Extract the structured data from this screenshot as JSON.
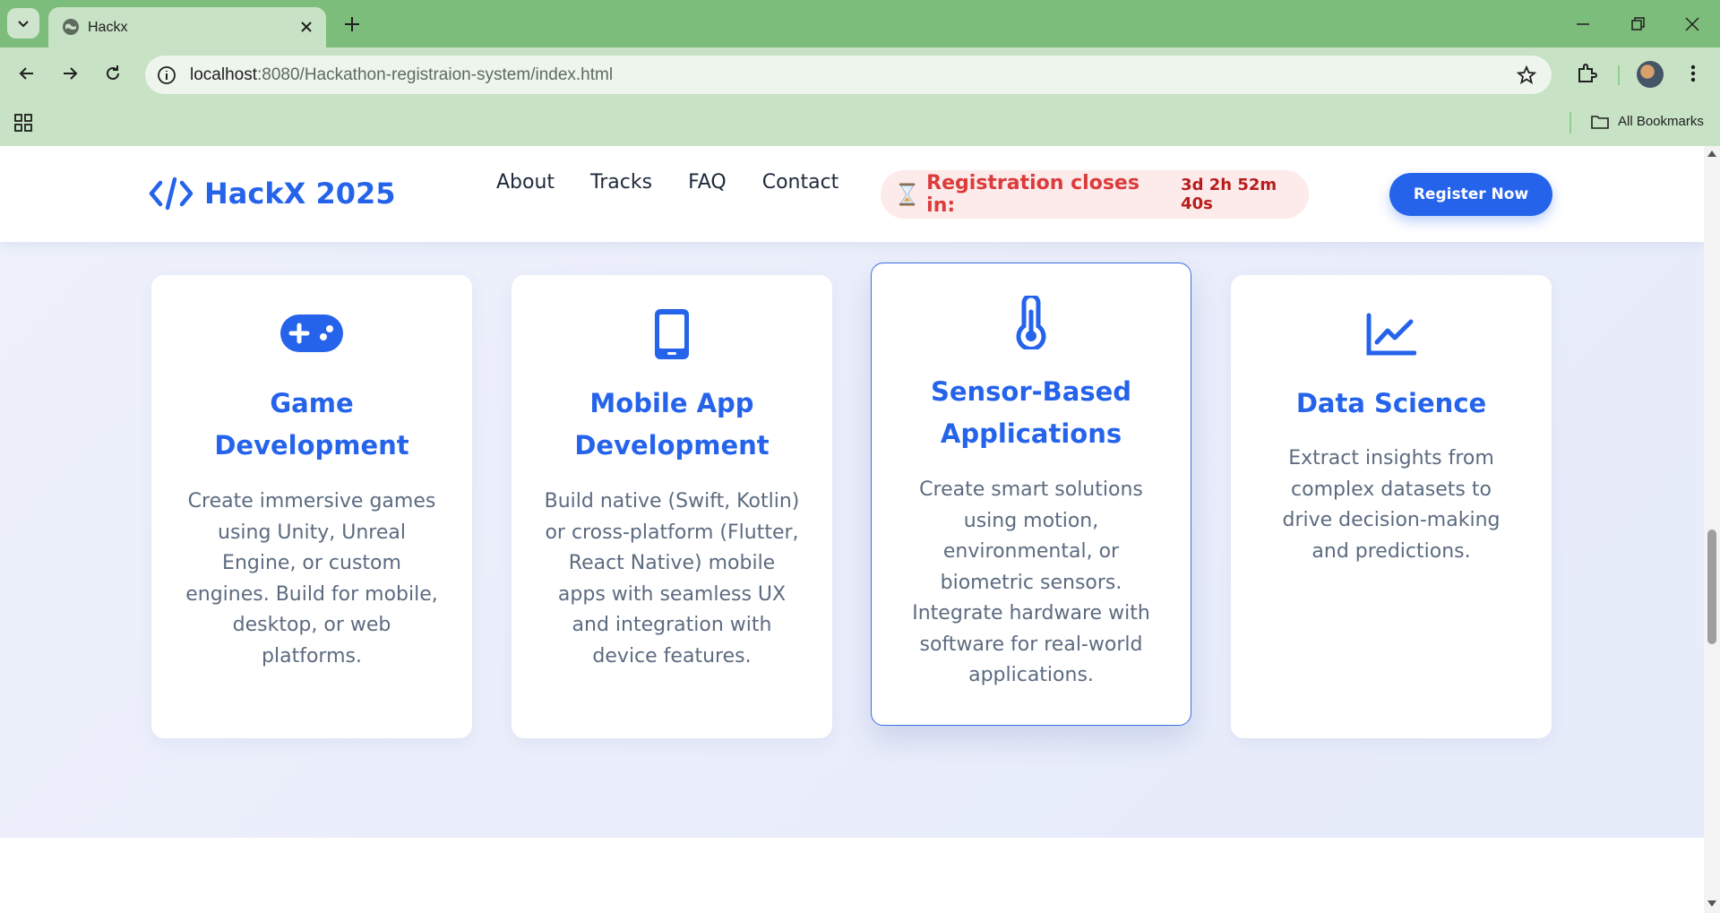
{
  "browser": {
    "tab_title": "Hackx",
    "url_host": "localhost",
    "url_path": ":8080/Hackathon-registraion-system/index.html",
    "bookmarks_label": "All Bookmarks"
  },
  "site": {
    "logo_text": "HackX 2025",
    "nav": [
      "About",
      "Tracks",
      "FAQ",
      "Contact"
    ],
    "countdown_label": "Registration closes in:",
    "countdown_value": "3d 2h 52m 40s",
    "register_label": "Register Now"
  },
  "tracks": [
    {
      "icon": "gamepad-icon",
      "title": "Game Development",
      "description": "Create immersive games using Unity, Unreal Engine, or custom engines. Build for mobile, desktop, or web platforms."
    },
    {
      "icon": "mobile-phone-icon",
      "title": "Mobile App Development",
      "description": "Build native (Swift, Kotlin) or cross-platform (Flutter, React Native) mobile apps with seamless UX and integration with device features."
    },
    {
      "icon": "thermometer-icon",
      "title": "Sensor-Based Applications",
      "description": "Create smart solutions using motion, environmental, or biometric sensors. Integrate hardware with software for real-world applications."
    },
    {
      "icon": "line-chart-icon",
      "title": "Data Science",
      "description": "Extract insights from complex datasets to drive decision-making and predictions."
    }
  ],
  "colors": {
    "accent": "#2563eb",
    "browser_frame": "#7dbd7b",
    "countdown_bg": "#fdeaea",
    "countdown_text": "#dc3b3b"
  }
}
